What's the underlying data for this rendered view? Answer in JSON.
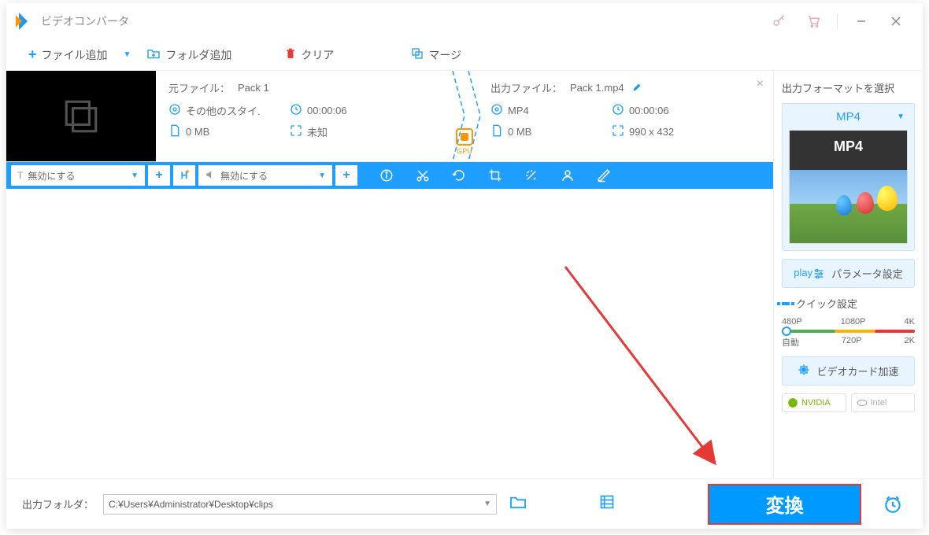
{
  "window": {
    "title": "ビデオコンバータ"
  },
  "toolbar": {
    "add_file": "ファイル追加",
    "add_folder": "フォルダ追加",
    "clear": "クリア",
    "merge": "マージ"
  },
  "file": {
    "source_label": "元ファイル：",
    "source_name": "Pack 1",
    "source_format": "その他のスタイ.",
    "source_duration": "00:00:06",
    "source_size": "0 MB",
    "source_resolution": "未知",
    "gpu_label": "GPU",
    "output_label": "出力ファイル：",
    "output_name": "Pack 1.mp4",
    "output_format": "MP4",
    "output_duration": "00:00:06",
    "output_size": "0 MB",
    "output_resolution": "990 x 432"
  },
  "editbar": {
    "text_disable": "無効にする",
    "audio_disable": "無効にする"
  },
  "right": {
    "title": "出力フォーマットを選択",
    "format": "MP4",
    "param_settings": "パラメータ設定",
    "quick_title": "クイック設定",
    "labels_top": [
      "480P",
      "1080P",
      "4K"
    ],
    "labels_bottom": [
      "自動",
      "720P",
      "2K"
    ],
    "gpu_accel": "ビデオカード加速",
    "nvidia": "NVIDIA",
    "intel": "Intel"
  },
  "bottom": {
    "out_label": "出力フォルダ：",
    "out_path": "C:¥Users¥Administrator¥Desktop¥clips",
    "convert": "変換"
  }
}
